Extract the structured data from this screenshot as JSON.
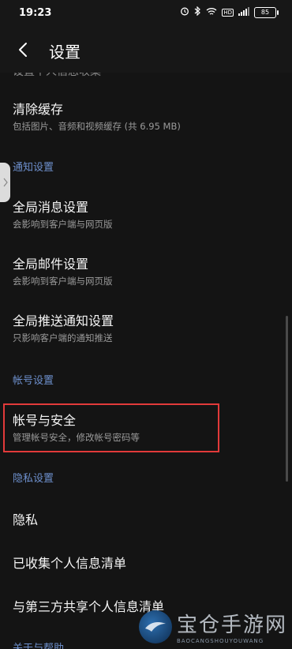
{
  "status_bar": {
    "time": "19:23",
    "battery": "85",
    "hd": "HD",
    "icons": [
      "alarm-icon",
      "bluetooth-icon",
      "wifi-icon",
      "hd-icon",
      "signal-icon",
      "battery-icon"
    ]
  },
  "header": {
    "title": "设置",
    "back_icon": "chevron-left-icon"
  },
  "clipped_row_text": "设置个人信息收集",
  "items": {
    "clear_cache": {
      "title": "清除缓存",
      "subtitle": "包括图片、音频和视频缓存 (共 6.95 MB)"
    },
    "global_message": {
      "title": "全局消息设置",
      "subtitle": "会影响到客户端与网页版"
    },
    "global_mail": {
      "title": "全局邮件设置",
      "subtitle": "会影响到客户端与网页版"
    },
    "global_push": {
      "title": "全局推送通知设置",
      "subtitle": "只影响客户端的通知推送"
    },
    "account_security": {
      "title": "帐号与安全",
      "subtitle": "管理帐号安全，修改帐号密码等"
    },
    "privacy": {
      "title": "隐私"
    },
    "collected_info": {
      "title": "已收集个人信息清单"
    },
    "third_party_info": {
      "title": "与第三方共享个人信息清单"
    }
  },
  "sections": {
    "notification": "通知设置",
    "account": "帐号设置",
    "privacy": "隐私设置",
    "about": "关于与帮助"
  },
  "colors": {
    "background": "#141414",
    "section_label": "#6d8fcc",
    "highlight": "#e23a3a"
  },
  "watermark": {
    "chinese": "宝仓手游网",
    "english": "BAOCANGSHOUYOUWANG"
  }
}
